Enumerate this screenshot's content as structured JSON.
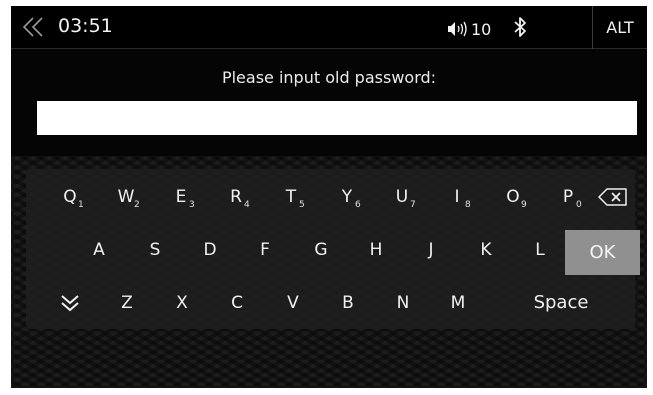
{
  "status_bar": {
    "time": "03:51",
    "volume_level": "10",
    "alt_label": "ALT",
    "icons": [
      "back-chevron-icon",
      "volume-icon",
      "bluetooth-icon"
    ]
  },
  "dialog": {
    "prompt": "Please input old password:",
    "input_value": ""
  },
  "keyboard": {
    "row1": [
      {
        "letter": "Q",
        "number": "1"
      },
      {
        "letter": "W",
        "number": "2"
      },
      {
        "letter": "E",
        "number": "3"
      },
      {
        "letter": "R",
        "number": "4"
      },
      {
        "letter": "T",
        "number": "5"
      },
      {
        "letter": "Y",
        "number": "6"
      },
      {
        "letter": "U",
        "number": "7"
      },
      {
        "letter": "I",
        "number": "8"
      },
      {
        "letter": "O",
        "number": "9"
      },
      {
        "letter": "P",
        "number": "0"
      }
    ],
    "row2": [
      "A",
      "S",
      "D",
      "F",
      "G",
      "H",
      "J",
      "K",
      "L"
    ],
    "row3": [
      "Z",
      "X",
      "C",
      "V",
      "B",
      "N",
      "M"
    ],
    "ok_label": "OK",
    "space_label": "Space",
    "backspace_icon": "backspace-icon",
    "hide_icon": "hide-keyboard-icon"
  },
  "colors": {
    "background": "#050505",
    "keyboard_panel": "#1e1e1e",
    "ok_key": "#909090",
    "input_field": "#ffffff"
  }
}
